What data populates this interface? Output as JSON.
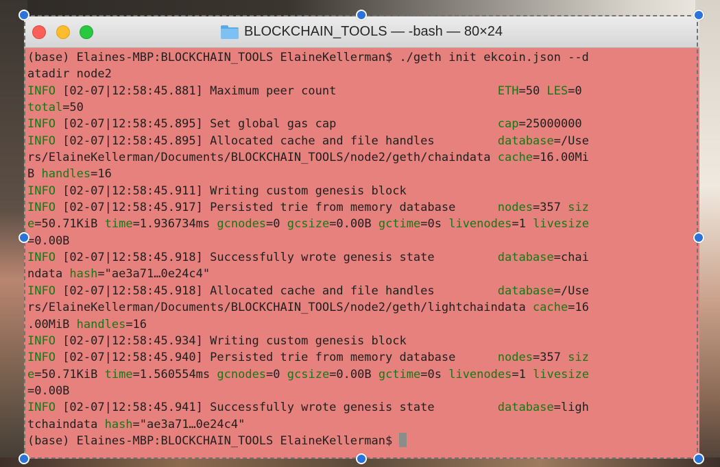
{
  "window": {
    "title": "BLOCKCHAIN_TOOLS — -bash — 80×24",
    "folder_icon": "folder-icon"
  },
  "terminal_lines": [
    [
      {
        "t": "(base) Elaines-MBP:BLOCKCHAIN_TOOLS ElaineKellerman$ ./geth init ekcoin.json --d",
        "c": ""
      }
    ],
    [
      {
        "t": "atadir node2",
        "c": ""
      }
    ],
    [
      {
        "t": "INFO",
        "c": "green"
      },
      {
        "t": " [02-07|12:58:45.881] Maximum peer count                       ",
        "c": ""
      },
      {
        "t": "ETH",
        "c": "green"
      },
      {
        "t": "=50 ",
        "c": ""
      },
      {
        "t": "LES",
        "c": "green"
      },
      {
        "t": "=0",
        "c": ""
      }
    ],
    [
      {
        "t": "total",
        "c": "green"
      },
      {
        "t": "=50",
        "c": ""
      }
    ],
    [
      {
        "t": "INFO",
        "c": "green"
      },
      {
        "t": " [02-07|12:58:45.895] Set global gas cap                       ",
        "c": ""
      },
      {
        "t": "cap",
        "c": "green"
      },
      {
        "t": "=25000000",
        "c": ""
      }
    ],
    [
      {
        "t": "INFO",
        "c": "green"
      },
      {
        "t": " [02-07|12:58:45.895] Allocated cache and file handles         ",
        "c": ""
      },
      {
        "t": "database",
        "c": "green"
      },
      {
        "t": "=/Use",
        "c": ""
      }
    ],
    [
      {
        "t": "rs/ElaineKellerman/Documents/BLOCKCHAIN_TOOLS/node2/geth/chaindata ",
        "c": ""
      },
      {
        "t": "cache",
        "c": "green"
      },
      {
        "t": "=16.00Mi",
        "c": ""
      }
    ],
    [
      {
        "t": "B ",
        "c": ""
      },
      {
        "t": "handles",
        "c": "green"
      },
      {
        "t": "=16",
        "c": ""
      }
    ],
    [
      {
        "t": "INFO",
        "c": "green"
      },
      {
        "t": " [02-07|12:58:45.911] Writing custom genesis block",
        "c": ""
      }
    ],
    [
      {
        "t": "INFO",
        "c": "green"
      },
      {
        "t": " [02-07|12:58:45.917] Persisted trie from memory database      ",
        "c": ""
      },
      {
        "t": "nodes",
        "c": "green"
      },
      {
        "t": "=357 ",
        "c": ""
      },
      {
        "t": "siz",
        "c": "green"
      }
    ],
    [
      {
        "t": "e",
        "c": "green"
      },
      {
        "t": "=50.71KiB ",
        "c": ""
      },
      {
        "t": "time",
        "c": "green"
      },
      {
        "t": "=1.936734ms ",
        "c": ""
      },
      {
        "t": "gcnodes",
        "c": "green"
      },
      {
        "t": "=0 ",
        "c": ""
      },
      {
        "t": "gcsize",
        "c": "green"
      },
      {
        "t": "=0.00B ",
        "c": ""
      },
      {
        "t": "gctime",
        "c": "green"
      },
      {
        "t": "=0s ",
        "c": ""
      },
      {
        "t": "livenodes",
        "c": "green"
      },
      {
        "t": "=1 ",
        "c": ""
      },
      {
        "t": "livesize",
        "c": "green"
      }
    ],
    [
      {
        "t": "=0.00B",
        "c": ""
      }
    ],
    [
      {
        "t": "INFO",
        "c": "green"
      },
      {
        "t": " [02-07|12:58:45.918] Successfully wrote genesis state         ",
        "c": ""
      },
      {
        "t": "database",
        "c": "green"
      },
      {
        "t": "=chai",
        "c": ""
      }
    ],
    [
      {
        "t": "ndata ",
        "c": ""
      },
      {
        "t": "hash",
        "c": "green"
      },
      {
        "t": "=\"ae3a71…0e24c4\"",
        "c": ""
      }
    ],
    [
      {
        "t": "INFO",
        "c": "green"
      },
      {
        "t": " [02-07|12:58:45.918] Allocated cache and file handles         ",
        "c": ""
      },
      {
        "t": "database",
        "c": "green"
      },
      {
        "t": "=/Use",
        "c": ""
      }
    ],
    [
      {
        "t": "rs/ElaineKellerman/Documents/BLOCKCHAIN_TOOLS/node2/geth/lightchaindata ",
        "c": ""
      },
      {
        "t": "cache",
        "c": "green"
      },
      {
        "t": "=16",
        "c": ""
      }
    ],
    [
      {
        "t": ".00MiB ",
        "c": ""
      },
      {
        "t": "handles",
        "c": "green"
      },
      {
        "t": "=16",
        "c": ""
      }
    ],
    [
      {
        "t": "INFO",
        "c": "green"
      },
      {
        "t": " [02-07|12:58:45.934] Writing custom genesis block",
        "c": ""
      }
    ],
    [
      {
        "t": "INFO",
        "c": "green"
      },
      {
        "t": " [02-07|12:58:45.940] Persisted trie from memory database      ",
        "c": ""
      },
      {
        "t": "nodes",
        "c": "green"
      },
      {
        "t": "=357 ",
        "c": ""
      },
      {
        "t": "siz",
        "c": "green"
      }
    ],
    [
      {
        "t": "e",
        "c": "green"
      },
      {
        "t": "=50.71KiB ",
        "c": ""
      },
      {
        "t": "time",
        "c": "green"
      },
      {
        "t": "=1.560554ms ",
        "c": ""
      },
      {
        "t": "gcnodes",
        "c": "green"
      },
      {
        "t": "=0 ",
        "c": ""
      },
      {
        "t": "gcsize",
        "c": "green"
      },
      {
        "t": "=0.00B ",
        "c": ""
      },
      {
        "t": "gctime",
        "c": "green"
      },
      {
        "t": "=0s ",
        "c": ""
      },
      {
        "t": "livenodes",
        "c": "green"
      },
      {
        "t": "=1 ",
        "c": ""
      },
      {
        "t": "livesize",
        "c": "green"
      }
    ],
    [
      {
        "t": "=0.00B",
        "c": ""
      }
    ],
    [
      {
        "t": "INFO",
        "c": "green"
      },
      {
        "t": " [02-07|12:58:45.941] Successfully wrote genesis state         ",
        "c": ""
      },
      {
        "t": "database",
        "c": "green"
      },
      {
        "t": "=ligh",
        "c": ""
      }
    ],
    [
      {
        "t": "tchaindata ",
        "c": ""
      },
      {
        "t": "hash",
        "c": "green"
      },
      {
        "t": "=\"ae3a71…0e24c4\"",
        "c": ""
      }
    ],
    [
      {
        "t": "(base) Elaines-MBP:BLOCKCHAIN_TOOLS ElaineKellerman$ ",
        "c": ""
      }
    ]
  ],
  "colors": {
    "terminal_background": "#e7817d",
    "key_green": "#137a13",
    "selection_handle": "#2a73d9"
  }
}
